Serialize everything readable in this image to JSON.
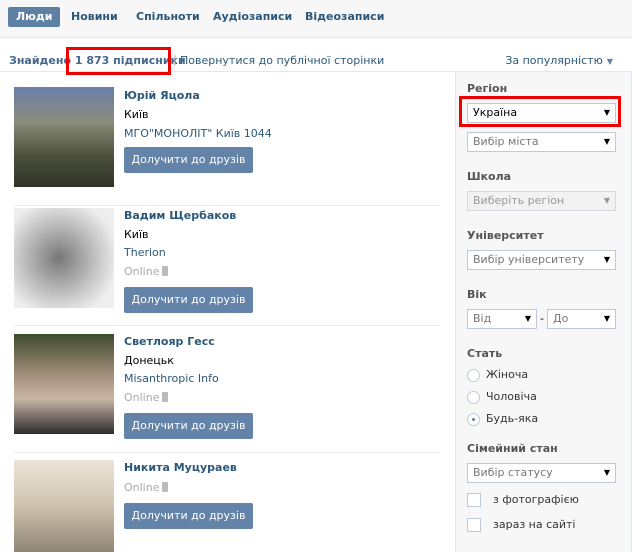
{
  "tabs": [
    {
      "label": "Люди",
      "active": true
    },
    {
      "label": "Новини"
    },
    {
      "label": "Спільноти"
    },
    {
      "label": "Аудіозаписи"
    },
    {
      "label": "Відеозаписи"
    }
  ],
  "summary": {
    "found_label": "Знайдено",
    "count": "1 873 підписники",
    "back_link": "Повернутися до публічної сторінки",
    "sort": "За популярністю"
  },
  "people": [
    {
      "name": "Юрій Яцола",
      "city": "Київ",
      "extra": "МГО\"МОНОЛІТ\" Київ 1044",
      "button": "Долучити до друзів"
    },
    {
      "name": "Вадим Щербаков",
      "city": "Київ",
      "extra": "Therion",
      "status": "Online",
      "button": "Долучити до друзів"
    },
    {
      "name": "Светлояр Гесс",
      "city": "Донецьк",
      "extra": "Misanthropic Info",
      "status": "Online",
      "button": "Долучити до друзів"
    },
    {
      "name": "Никита Муцураев",
      "status": "Online",
      "button": "Долучити до друзів"
    }
  ],
  "filters": {
    "region_label": "Регіон",
    "region_value": "Україна",
    "city_placeholder": "Вибір міста",
    "school_label": "Школа",
    "school_placeholder": "Виберіть регіон",
    "university_label": "Університет",
    "university_placeholder": "Вибір університету",
    "age_label": "Вік",
    "age_from": "Від",
    "age_dash": "-",
    "age_to": "До",
    "sex_label": "Стать",
    "sex_options": [
      "Жіноча",
      "Чоловіча",
      "Будь-яка"
    ],
    "sex_selected": "Будь-яка",
    "family_label": "Сімейний стан",
    "family_placeholder": "Вибір статусу",
    "with_photo": "з фотографією",
    "online_now": "зараз на сайті"
  },
  "colors": {
    "accent": "#5e80a5",
    "link": "#2b587a",
    "highlight": "#ee0000"
  }
}
